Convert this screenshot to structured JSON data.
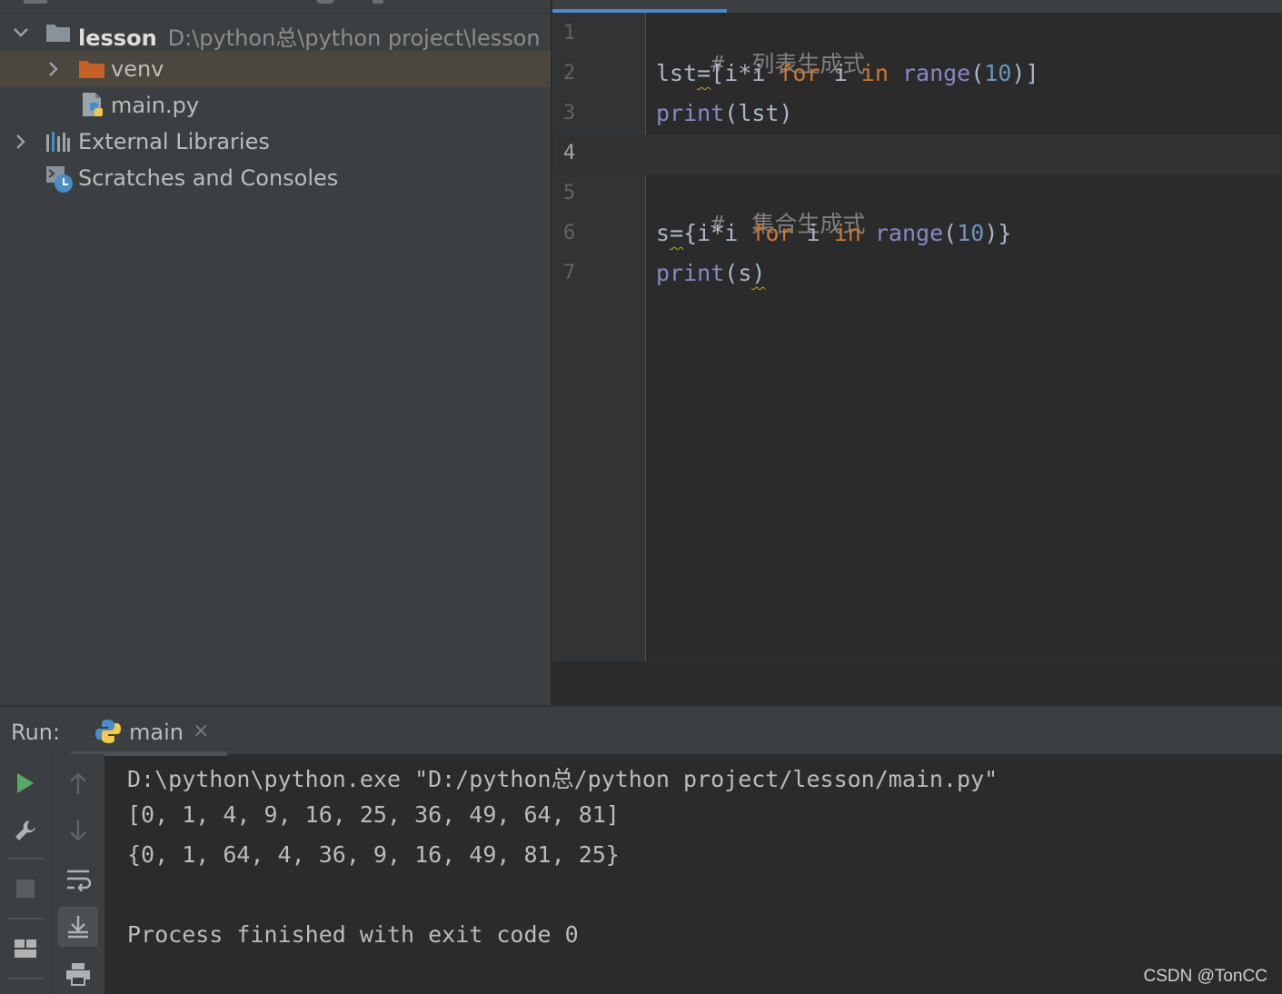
{
  "project": {
    "root_name": "lesson",
    "root_path": "D:\\python总\\python project\\lesson",
    "items": [
      {
        "label": "venv"
      },
      {
        "label": "main.py"
      },
      {
        "label": "External Libraries"
      },
      {
        "label": "Scratches and Consoles"
      }
    ]
  },
  "editor": {
    "line_numbers": [
      "1",
      "2",
      "3",
      "4",
      "5",
      "6",
      "7"
    ],
    "lines": [
      {
        "comment": "#  列表生成式"
      },
      {
        "t0": "lst",
        "t1": "=",
        "t2": "[i*i ",
        "kw1": "for",
        "t3": " i ",
        "kw2": "in",
        "t4": " ",
        "fn": "range",
        "t5": "(",
        "num": "10",
        "t6": ")]"
      },
      {
        "fn": "print",
        "t1": "(lst)"
      },
      {},
      {
        "comment": "#  集合生成式"
      },
      {
        "t0": "s",
        "t1": "=",
        "t2": "{i*i ",
        "kw1": "for",
        "t3": " i ",
        "kw2": "in",
        "t4": " ",
        "fn": "range",
        "t5": "(",
        "num": "10",
        "t6": ")}"
      },
      {
        "fn": "print",
        "t1": "(s",
        "t2": ")"
      }
    ]
  },
  "run": {
    "label": "Run:",
    "tab_label": "main",
    "close_glyph": "×",
    "console": [
      "D:\\python\\python.exe \"D:/python总/python project/lesson/main.py\"",
      "[0, 1, 4, 9, 16, 25, 36, 49, 64, 81]",
      "{0, 1, 64, 4, 36, 9, 16, 49, 81, 25}",
      "",
      "Process finished with exit code 0"
    ]
  },
  "icons": {
    "folder": "folder-icon",
    "excluded_folder": "venv-folder-icon",
    "python_file": "python-file-icon",
    "libraries": "libraries-icon",
    "scratches": "scratches-icon",
    "run": "run-icon",
    "wrench": "wrench-icon",
    "stop": "stop-icon",
    "layout": "layout-icon",
    "up": "arrow-up-icon",
    "down": "arrow-down-icon",
    "soft_wrap": "soft-wrap-icon",
    "scroll_end": "scroll-to-end-icon",
    "print": "print-icon"
  },
  "colors": {
    "keyword": "#cc7832",
    "builtin": "#8888c6",
    "number": "#6897bb",
    "comment": "#808080",
    "run_green": "#59a869"
  },
  "watermark": "CSDN @TonCC"
}
